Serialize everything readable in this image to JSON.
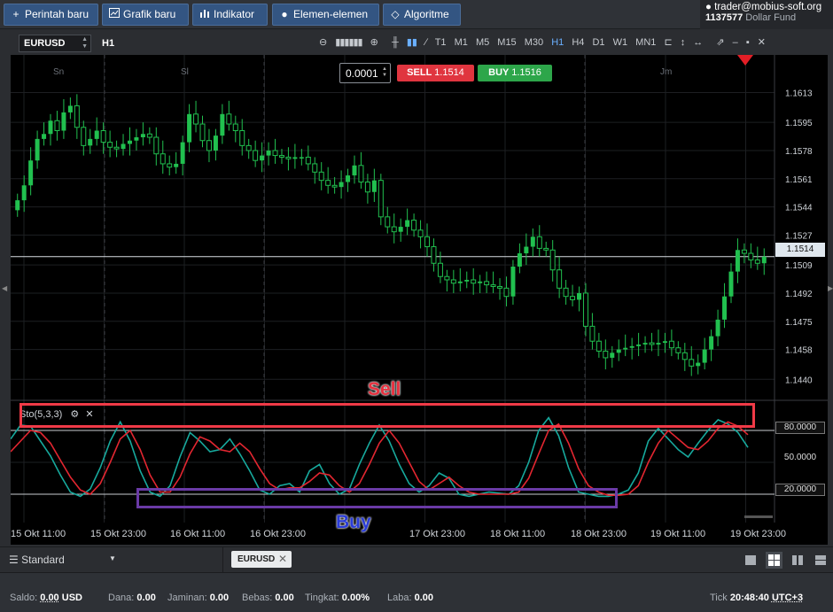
{
  "topbar": {
    "buttons": [
      {
        "icon": "plus-icon",
        "label": "Perintah baru"
      },
      {
        "icon": "chart-window-icon",
        "label": "Grafik baru"
      },
      {
        "icon": "bar-chart-icon",
        "label": "Indikator"
      },
      {
        "icon": "palette-icon",
        "label": "Elemen-elemen"
      },
      {
        "icon": "diamond-icon",
        "label": "Algoritme"
      }
    ],
    "account": {
      "user": "trader@mobius-soft.org",
      "id": "1137577",
      "fund": "Dollar Fund"
    }
  },
  "toolbar": {
    "symbol": "EURUSD",
    "current_timeframe": "H1",
    "timeframes": [
      "T1",
      "M1",
      "M5",
      "M15",
      "M30",
      "H1",
      "H4",
      "D1",
      "W1",
      "MN1"
    ],
    "active_timeframe": "H1"
  },
  "trade": {
    "lot": "0.0001",
    "sell_label": "SELL",
    "sell_price": "1.1514",
    "buy_label": "BUY",
    "buy_price": "1.1516"
  },
  "chart": {
    "day_labels": [
      "Sn",
      "Sl",
      "Jm"
    ],
    "price_ticks": [
      "1.1613",
      "1.1595",
      "1.1578",
      "1.1561",
      "1.1544",
      "1.1527",
      "1.1509",
      "1.1492",
      "1.1475",
      "1.1458",
      "1.1440"
    ],
    "current_price": "1.1514",
    "time_ticks": [
      "15 Okt 11:00",
      "15 Okt 23:00",
      "16 Okt 11:00",
      "16 Okt 23:00",
      "17 Okt 23:00",
      "18 Okt 11:00",
      "18 Okt 23:00",
      "19 Okt 11:00",
      "19 Okt 23:00"
    ]
  },
  "indicator": {
    "title": "Sto(5,3,3)",
    "levels": [
      "80.0000",
      "50.0000",
      "20.0000"
    ]
  },
  "annotations": {
    "sell": "Sell",
    "buy": "Buy"
  },
  "bottom": {
    "layout_label": "Standard",
    "tab": "EURUSD"
  },
  "status": {
    "saldo_label": "Saldo:",
    "saldo": "0.00",
    "currency": "USD",
    "dana_label": "Dana:",
    "dana": "0.00",
    "jaminan_label": "Jaminan:",
    "jaminan": "0.00",
    "bebas_label": "Bebas:",
    "bebas": "0.00",
    "tingkat_label": "Tingkat:",
    "tingkat": "0.00%",
    "laba_label": "Laba:",
    "laba": "0.00",
    "tick_label": "Tick",
    "time": "20:48:40",
    "tz": "UTC+3"
  },
  "colors": {
    "bull": "#21c04f",
    "stoch_k": "#17a99d",
    "stoch_d": "#e32630",
    "sell": "#e0353f",
    "buy": "#2da64a"
  },
  "chart_data": {
    "type": "candlestick",
    "candles_close": [
      1.1548,
      1.1557,
      1.1572,
      1.1585,
      1.1588,
      1.1596,
      1.159,
      1.1601,
      1.1605,
      1.1592,
      1.1581,
      1.1585,
      1.159,
      1.1583,
      1.158,
      1.1579,
      1.1582,
      1.1584,
      1.1586,
      1.1588,
      1.1586,
      1.1576,
      1.157,
      1.1568,
      1.157,
      1.1583,
      1.16,
      1.1594,
      1.1584,
      1.1578,
      1.1587,
      1.16,
      1.1594,
      1.159,
      1.1581,
      1.1578,
      1.1572,
      1.1575,
      1.1578,
      1.1575,
      1.1574,
      1.1573,
      1.1574,
      1.1574,
      1.157,
      1.1565,
      1.156,
      1.1557,
      1.1556,
      1.1559,
      1.1563,
      1.1569,
      1.1559,
      1.1553,
      1.156,
      1.1538,
      1.1532,
      1.1529,
      1.1532,
      1.1536,
      1.153,
      1.1526,
      1.152,
      1.151,
      1.1502,
      1.15,
      1.1498,
      1.1499,
      1.15,
      1.1498,
      1.1499,
      1.1497,
      1.1496,
      1.1495,
      1.149,
      1.1508,
      1.1516,
      1.152,
      1.1526,
      1.1519,
      1.1518,
      1.1506,
      1.1495,
      1.149,
      1.1488,
      1.1492,
      1.1472,
      1.1463,
      1.1457,
      1.1453,
      1.1456,
      1.1458,
      1.1459,
      1.146,
      1.1461,
      1.1462,
      1.1461,
      1.1462,
      1.1463,
      1.1459,
      1.1456,
      1.1452,
      1.1448,
      1.145,
      1.1458,
      1.1466,
      1.1476,
      1.149,
      1.1505,
      1.1518,
      1.1516,
      1.1512,
      1.151,
      1.1514
    ],
    "stoch_k": [
      72,
      85,
      84,
      70,
      56,
      38,
      22,
      18,
      25,
      45,
      70,
      88,
      70,
      42,
      22,
      18,
      28,
      55,
      78,
      70,
      60,
      62,
      72,
      58,
      42,
      24,
      20,
      28,
      30,
      22,
      42,
      48,
      30,
      20,
      25,
      48,
      68,
      85,
      70,
      48,
      30,
      22,
      28,
      40,
      35,
      20,
      18,
      20,
      22,
      21,
      20,
      28,
      50,
      80,
      92,
      75,
      45,
      22,
      20,
      18,
      18,
      20,
      24,
      40,
      70,
      82,
      72,
      62,
      55,
      68,
      80,
      90,
      86,
      78,
      64
    ],
    "stoch_d": [
      60,
      70,
      80,
      78,
      68,
      52,
      36,
      24,
      20,
      30,
      50,
      72,
      80,
      62,
      38,
      22,
      22,
      36,
      58,
      74,
      70,
      62,
      60,
      68,
      60,
      44,
      30,
      24,
      26,
      26,
      32,
      40,
      38,
      28,
      22,
      30,
      48,
      68,
      80,
      68,
      50,
      32,
      24,
      30,
      36,
      28,
      22,
      20,
      20,
      20,
      20,
      22,
      35,
      58,
      80,
      86,
      68,
      44,
      28,
      22,
      19,
      19,
      20,
      28,
      50,
      68,
      80,
      72,
      64,
      62,
      70,
      82,
      88,
      84,
      76
    ]
  }
}
